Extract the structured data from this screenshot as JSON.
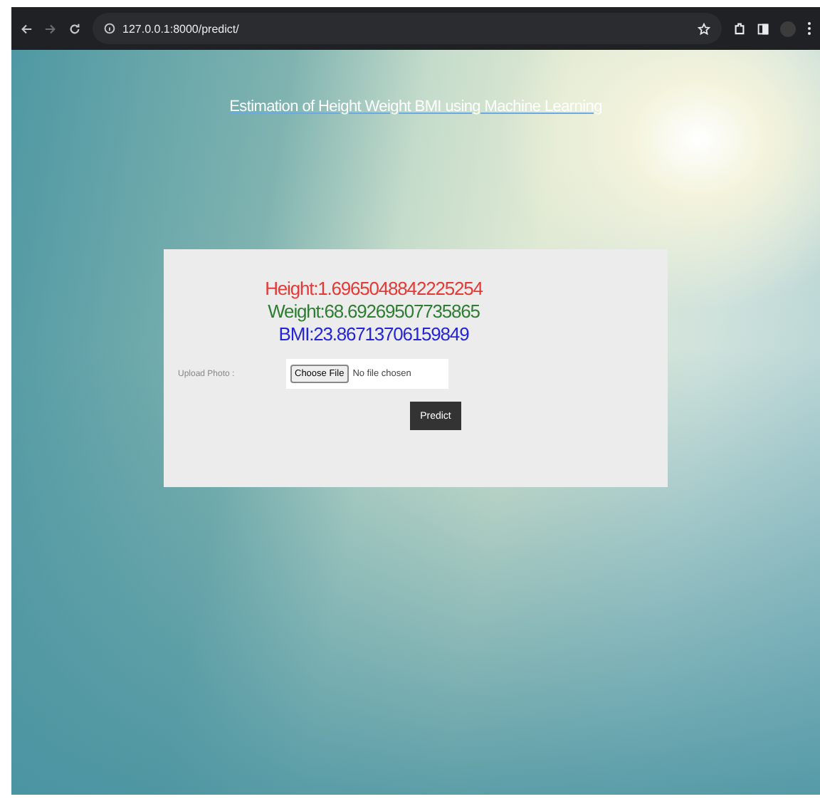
{
  "browser": {
    "url": "127.0.0.1:8000/predict/"
  },
  "page": {
    "title": "Estimation of Height Weight BMI using Machine Learning",
    "results": [
      {
        "text": "Height:1.6965048842225254",
        "color": "#e53935"
      },
      {
        "text": "Weight:68.69269507735865",
        "color": "#2e7d32"
      },
      {
        "text": "BMI:23.86713706159849",
        "color": "#2424d8"
      }
    ],
    "upload": {
      "label": "Upload Photo :",
      "button": "Choose File",
      "status": "No file chosen"
    },
    "submit": "Predict"
  }
}
